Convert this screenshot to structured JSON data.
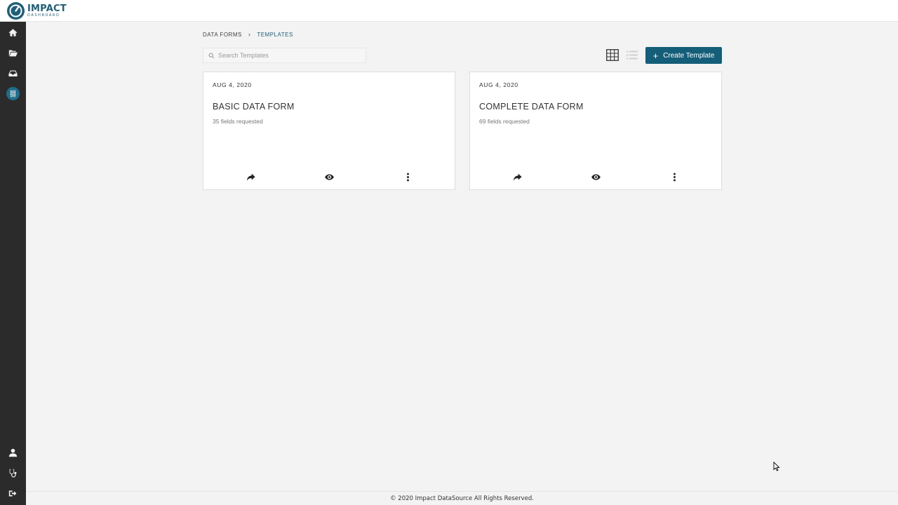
{
  "app": {
    "logo_title": "IMPACT",
    "logo_subtitle": "DASHBOARD",
    "brand_color": "#1e5f7a",
    "accent_color": "#155e7a"
  },
  "sidebar": {
    "items": [
      {
        "icon": "home-icon"
      },
      {
        "icon": "folder-open-icon"
      },
      {
        "icon": "inbox-icon"
      },
      {
        "icon": "sliders-icon",
        "active": true
      }
    ],
    "bottom_items": [
      {
        "icon": "user-icon"
      },
      {
        "icon": "stethoscope-icon"
      },
      {
        "icon": "sign-out-icon"
      }
    ]
  },
  "breadcrumb": {
    "items": [
      "DATA FORMS",
      "TEMPLATES"
    ],
    "separator": "›"
  },
  "search": {
    "placeholder": "Search Templates",
    "value": ""
  },
  "toolbar": {
    "grid_view_active": true,
    "create_label": "Create Template",
    "create_icon": "+"
  },
  "templates": [
    {
      "date": "AUG 4, 2020",
      "title": "BASIC DATA FORM",
      "fields": "35 fields requested"
    },
    {
      "date": "AUG 4, 2020",
      "title": "COMPLETE DATA FORM",
      "fields": "69 fields requested"
    }
  ],
  "footer": {
    "text": "© 2020 Impact DataSource All Rights Reserved."
  }
}
